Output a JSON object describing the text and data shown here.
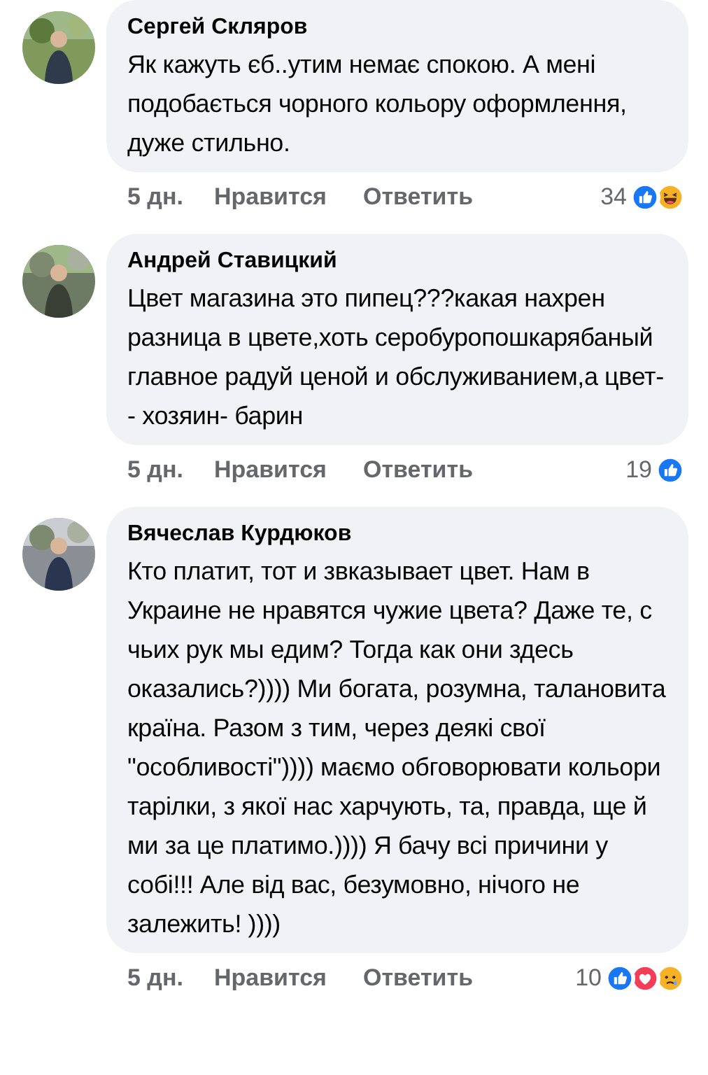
{
  "comments": [
    {
      "author": "Сергей Скляров",
      "text": "Як кажуть єб..утим немає спокою. А мені подобається чорного кольору оформлення, дуже стильно.",
      "time": "5 дн.",
      "like_action": "Нравится",
      "reply_action": "Ответить",
      "reaction_count": "34",
      "reactions": [
        {
          "kind": "like"
        },
        {
          "kind": "haha"
        }
      ]
    },
    {
      "author": "Андрей Ставицкий",
      "text": "Цвет магазина это пипец???какая нахрен разница в цвете,хоть серобуропошкарябаный главное радуй ценой и обслуживанием,а цвет-- хозяин- барин",
      "time": "5 дн.",
      "like_action": "Нравится",
      "reply_action": "Ответить",
      "reaction_count": "19",
      "reactions": [
        {
          "kind": "like"
        }
      ]
    },
    {
      "author": "Вячеслав Курдюков",
      "text": "Кто платит, тот и звказывает цвет. Нам в Украине не нравятся чужие цвета? Даже те, с чьих рук мы едим? Тогда как они здесь оказались?)))) Ми богата, розумна, талановита країна. Разом з тим, через деякі свої \"особливості\")))) маємо обговорювати кольори тарілки, з якої нас харчують, та, правда, ще й ми за це платимо.)))) Я бачу всі причини у собі!!! Але від вас, безумовно, нічого не залежить! ))))",
      "time": "5 дн.",
      "like_action": "Нравится",
      "reply_action": "Ответить",
      "reaction_count": "10",
      "reactions": [
        {
          "kind": "like"
        },
        {
          "kind": "love"
        },
        {
          "kind": "sad"
        }
      ]
    }
  ]
}
